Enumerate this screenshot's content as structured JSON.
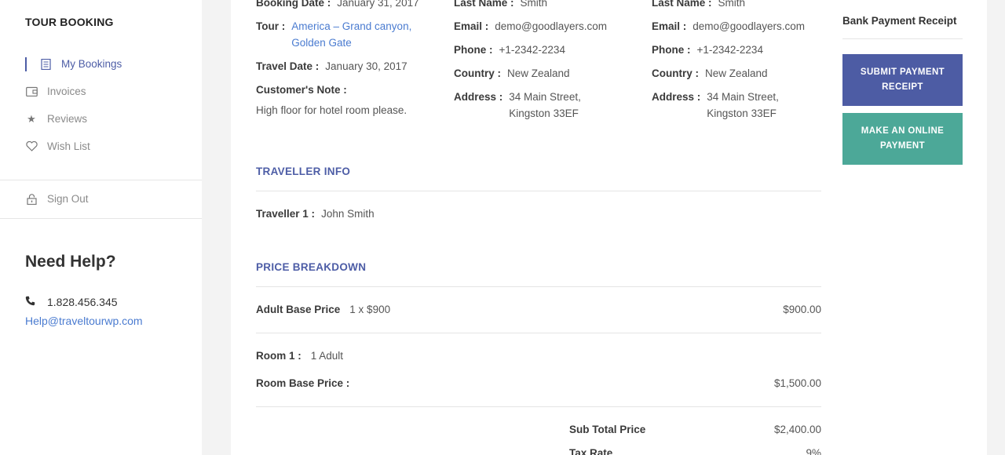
{
  "sidebar": {
    "title": "TOUR BOOKING",
    "items": [
      {
        "label": "My Bookings",
        "icon": "document-icon"
      },
      {
        "label": "Invoices",
        "icon": "wallet-icon"
      },
      {
        "label": "Reviews",
        "icon": "star-icon"
      },
      {
        "label": "Wish List",
        "icon": "heart-icon"
      }
    ],
    "signout": "Sign Out",
    "help": {
      "title": "Need Help?",
      "phone": "1.828.456.345",
      "email": "Help@traveltourwp.com"
    }
  },
  "booking": {
    "col1": {
      "booking_date_label": "Booking Date :",
      "booking_date": "January 31, 2017",
      "tour_label": "Tour :",
      "tour_line1": "America – Grand canyon,",
      "tour_line2": "Golden Gate",
      "travel_date_label": "Travel Date :",
      "travel_date": "January 30, 2017",
      "note_label": "Customer's Note :",
      "note": "High floor for hotel room please."
    },
    "col2": {
      "last_name_label": "Last Name :",
      "last_name": "Smith",
      "email_label": "Email :",
      "email": "demo@goodlayers.com",
      "phone_label": "Phone :",
      "phone": "+1-2342-2234",
      "country_label": "Country :",
      "country": "New Zealand",
      "address_label": "Address :",
      "address_line1": "34 Main Street,",
      "address_line2": "Kingston 33EF"
    },
    "col3": {
      "last_name_label": "Last Name :",
      "last_name": "Smith",
      "email_label": "Email :",
      "email": "demo@goodlayers.com",
      "phone_label": "Phone :",
      "phone": "+1-2342-2234",
      "country_label": "Country :",
      "country": "New Zealand",
      "address_label": "Address :",
      "address_line1": "34 Main Street,",
      "address_line2": "Kingston 33EF"
    }
  },
  "traveller": {
    "title": "TRAVELLER INFO",
    "label": "Traveller 1 :",
    "name": "John Smith"
  },
  "price": {
    "title": "PRICE BREAKDOWN",
    "adult_label": "Adult Base Price",
    "adult_detail": "1 x $900",
    "adult_amount": "$900.00",
    "room_label": "Room 1 :",
    "room_detail": "1 Adult",
    "room_base_label": "Room Base Price :",
    "room_base_amount": "$1,500.00",
    "subtotal_label": "Sub Total Price",
    "subtotal_amount": "$2,400.00",
    "tax_label": "Tax Rate",
    "tax_amount": "9%"
  },
  "payment": {
    "title": "Bank Payment Receipt",
    "submit_label": "SUBMIT PAYMENT RECEIPT",
    "online_label": "MAKE AN ONLINE PAYMENT"
  }
}
